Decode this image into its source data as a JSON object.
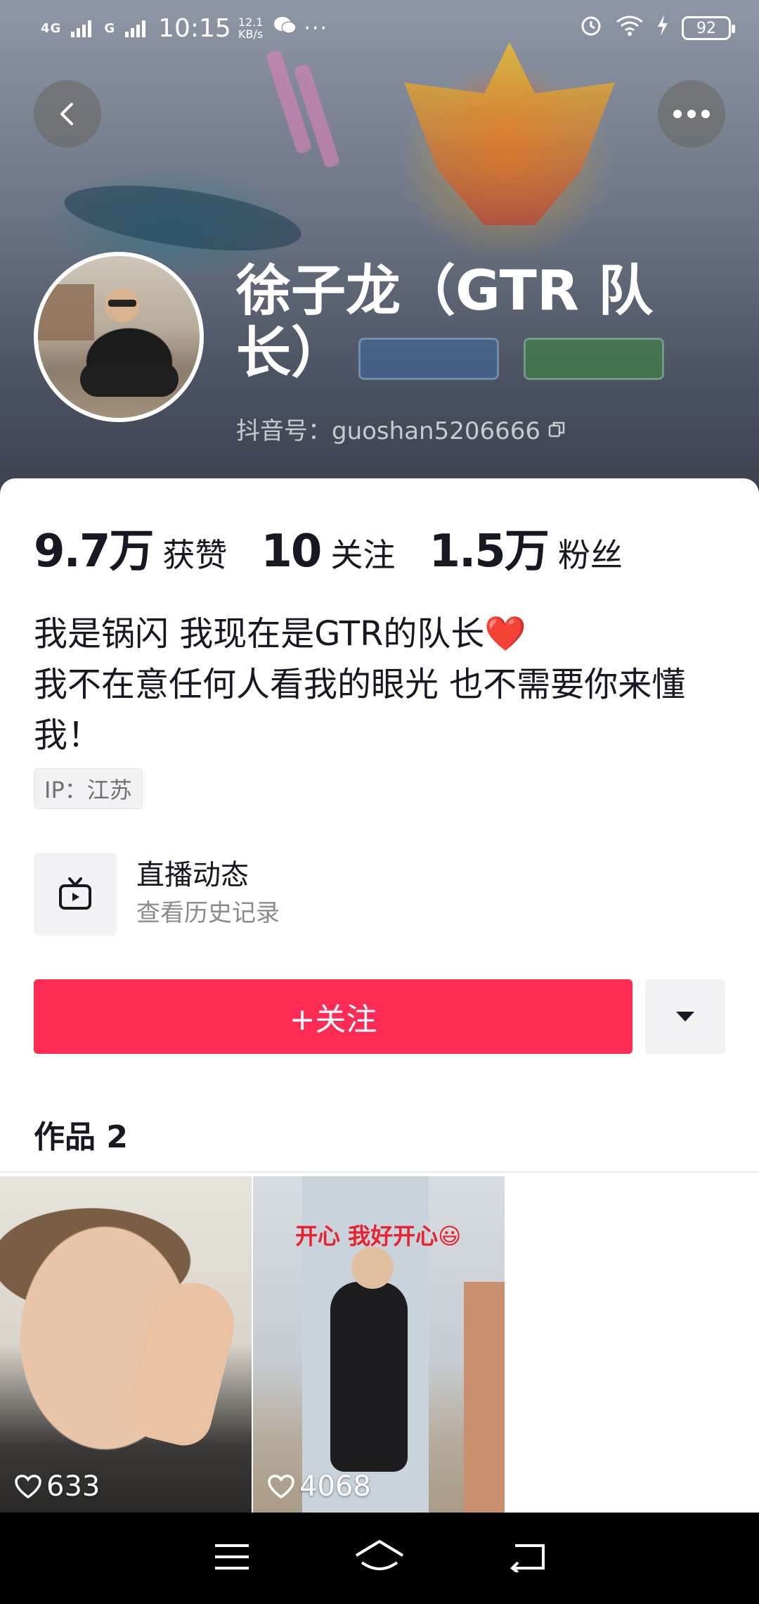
{
  "status_bar": {
    "network_1": "4G",
    "network_2": "G",
    "time": "10:15",
    "speed_value": "12.1",
    "speed_unit": "KB/s",
    "more": "···",
    "battery": "92"
  },
  "profile": {
    "name": "徐子龙（GTR 队长）",
    "douyin_id": "抖音号：guoshan5206666"
  },
  "stats": [
    {
      "value": "9.7万",
      "label": "获赞"
    },
    {
      "value": "10",
      "label": "关注"
    },
    {
      "value": "1.5万",
      "label": "粉丝"
    }
  ],
  "bio": {
    "line1": "我是锅闪  我现在是GTR的队长",
    "heart": "❤️",
    "line2": "我不在意任何人看我的眼光 也不需要你来懂我！"
  },
  "ip_tag": "IP：江苏",
  "live": {
    "title": "直播动态",
    "subtitle": "查看历史记录"
  },
  "follow_button": "+关注",
  "works": {
    "title": "作品 2",
    "items": [
      {
        "likes": "633"
      },
      {
        "likes": "4068",
        "caption": "开心 我好开心😃"
      }
    ]
  },
  "colors": {
    "accent": "#fe2c55",
    "text": "#161823"
  }
}
